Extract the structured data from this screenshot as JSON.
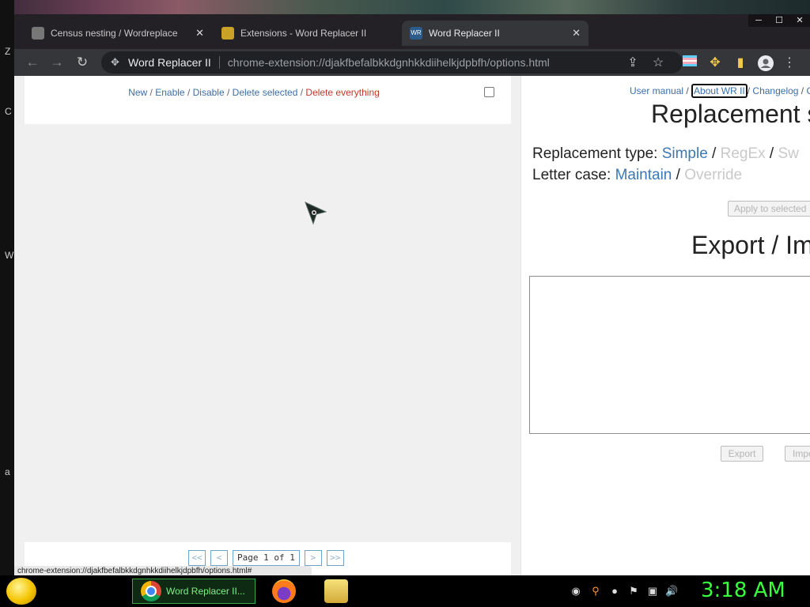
{
  "browser": {
    "tabs": [
      {
        "title": "Census nesting / Wordreplace",
        "active": false
      },
      {
        "title": "Extensions - Word Replacer II",
        "active": false
      },
      {
        "title": "Word Replacer II",
        "active": true
      }
    ],
    "omnibox": {
      "site_name": "Word Replacer II",
      "url": "chrome-extension://djakfbefalbkkdgnhkkdiihelkjdpbfh/options.html"
    },
    "status_url": "chrome-extension://djakfbefalbkkdgnhkkdiihelkjdpbfh/options.html#"
  },
  "left_panel": {
    "actions": {
      "new": "New",
      "enable": "Enable",
      "disable": "Disable",
      "delete_selected": "Delete selected",
      "delete_everything": "Delete everything",
      "separator": " / "
    },
    "pagination": {
      "first": "<<",
      "prev": "<",
      "page_info": "Page 1 of 1",
      "next": ">",
      "last": ">>"
    }
  },
  "right_panel": {
    "links": {
      "user_manual": "User manual",
      "about": "About WR II",
      "changelog": "Changelog",
      "trailing": "C"
    },
    "replacement_heading": "Replacement settings",
    "replacement_type": {
      "label": "Replacement type:",
      "simple": "Simple",
      "regex": "RegEx",
      "third": "Sw"
    },
    "letter_case": {
      "label": "Letter case:",
      "maintain": "Maintain",
      "override": "Override"
    },
    "apply_button": "Apply to selected",
    "export_heading": "Export / Import",
    "export_text": "",
    "export_button": "Export",
    "import_button": "Import"
  },
  "taskbar": {
    "active_task": "Word Replacer II...",
    "clock": "3:18 AM"
  },
  "colors": {
    "link": "#3b6fa8",
    "danger": "#c0392b",
    "clock": "#39ff3c"
  }
}
